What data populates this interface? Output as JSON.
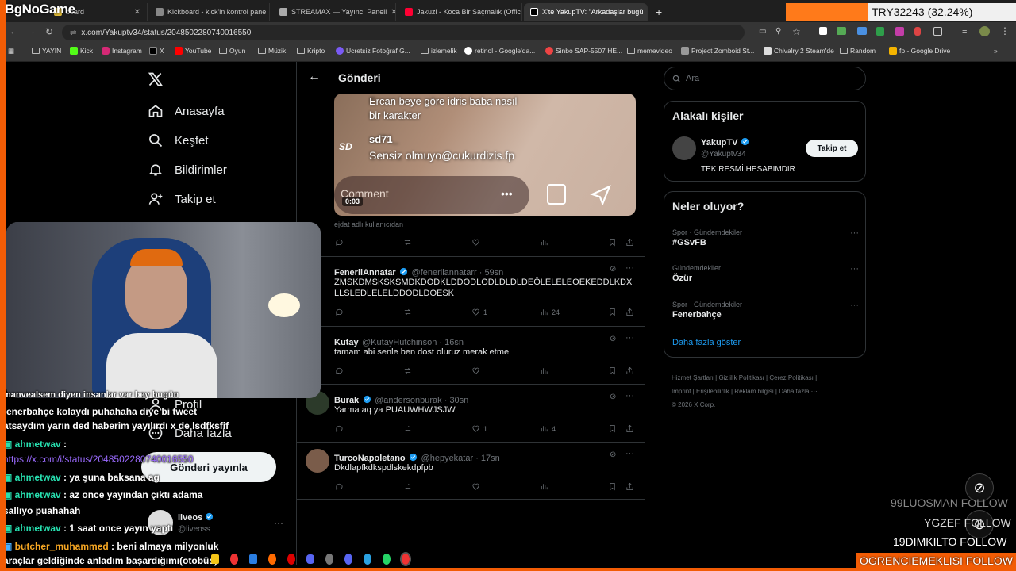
{
  "overlay": {
    "logo_text": "BgNoGame",
    "top_right_text": "TRY32243 (32.24%)"
  },
  "browser": {
    "tabs": [
      {
        "label": "board",
        "color": "#e8c23a"
      },
      {
        "label": "Kickboard - kick'in kontrol pane",
        "color": "#888888"
      },
      {
        "label": "STREAMAX — Yayıncı Paneli",
        "color": "#aaaaaa"
      },
      {
        "label": "Jakuzi - Koca Bir Saçmalık (Offic",
        "color": "#ff0033"
      },
      {
        "label": "X'te YakupTV: \"Arkadaşlar bugü",
        "color": "#ffffff"
      }
    ],
    "new_tab_label": "+",
    "url": "x.com/Yakuptv34/status/2048502280740016550",
    "bookmarks": [
      "YAYIN",
      "Kick",
      "Instagram",
      "X",
      "YouTube",
      "Oyun",
      "Müzik",
      "Kripto",
      "Ücretsiz Fotoğraf G...",
      "izlemelik",
      "retinol - Google'da...",
      "Sinbo SAP-5507 HE...",
      "memevideo",
      "Project Zomboid St...",
      "Chivalry 2 Steam'de",
      "Random",
      "fp - Google Drive"
    ]
  },
  "x_nav": {
    "items": [
      {
        "label": "Anasayfa",
        "icon": "home-icon"
      },
      {
        "label": "Keşfet",
        "icon": "search-icon"
      },
      {
        "label": "Bildirimler",
        "icon": "bell-icon"
      },
      {
        "label": "Takip et",
        "icon": "add-person-icon"
      }
    ],
    "profile_label": "Profil",
    "more_label": "Daha fazla",
    "post_button": "Gönderi yayınla",
    "account_name": "liveos",
    "account_handle": "@liveoss"
  },
  "header": {
    "title": "Gönderi"
  },
  "video": {
    "line1": "Ercan beye göre idris baba nasıl",
    "line2": "bir karakter",
    "user": "sd71_",
    "comment": "Sensiz olmuyo@cukurdizis.fp",
    "comment_placeholder": "Comment",
    "time": "0:03",
    "source_text": "ejdat adlı kullanıcıdan"
  },
  "replies": [
    {
      "name": "FenerliAnnatar",
      "handle": "@fenerliannatarr",
      "time": "59sn",
      "text": "ZMSKDMSKSKSMDKDODKLDDODLODLDLDLDEÖLELELEOEKEDDLKDXLLSLEDLELELDDODLDOESK",
      "likes": "1",
      "views": "24"
    },
    {
      "name": "Kutay",
      "handle": "@KutayHutchinson",
      "time": "16sn",
      "text": "tamam abi senle ben dost oluruz merak etme",
      "likes": "",
      "views": ""
    },
    {
      "name": "Burak",
      "handle": "@andersonburak",
      "time": "30sn",
      "text": "Yarma aq ya PUAUWHWJSJW",
      "likes": "1",
      "views": "4"
    },
    {
      "name": "TurcoNapoletano",
      "handle": "@hepyekatar",
      "time": "17sn",
      "text": "Dkdlapfkdkspdlskekdpfpb",
      "likes": "",
      "views": ""
    }
  ],
  "search": {
    "placeholder": "Ara"
  },
  "related": {
    "title": "Alakalı kişiler",
    "name": "YakupTV",
    "handle": "@Yakuptv34",
    "bio": "TEK RESMİ HESABIMDIR",
    "follow_button": "Takip et"
  },
  "trends": {
    "title": "Neler oluyor?",
    "items": [
      {
        "context": "Spor · Gündemdekiler",
        "name": "#GSvFB"
      },
      {
        "context": "Gündemdekiler",
        "name": "Özür"
      },
      {
        "context": "Spor · Gündemdekiler",
        "name": "Fenerbahçe"
      }
    ],
    "show_more": "Daha fazla göster"
  },
  "footer": {
    "links": [
      "Hizmet Şartları",
      "Gizlilik Politikası",
      "Çerez Politikası",
      "Imprint",
      "Erişilebilirlik",
      "Reklam bilgisi",
      "Daha fazla ···"
    ],
    "copyright": "© 2026 X Corp."
  },
  "chat": {
    "lines": [
      {
        "text": "manvealsem diyen insanlar var bey bugün"
      },
      {
        "text": "fenerbahçe kolaydı puhahaha diye bi tweet"
      },
      {
        "text": "atsaydım yarın ded haberim yayılırdı x de lsdfksfif"
      },
      {
        "user": "ahmetwav",
        "text": ":"
      },
      {
        "link": "https://x.com/i/status/2048502280740016550"
      },
      {
        "user": "ahmetwav",
        "text": ": ya şuna baksana ag"
      },
      {
        "user": "ahmetwav",
        "text": ": az once yayından çıktı adama"
      },
      {
        "text": "sallıyo puahahah"
      },
      {
        "user": "ahmetwav",
        "text": ": 1 saat once yayın yaptı"
      },
      {
        "user": "butcher_muhammed",
        "text": ": beni almaya milyonluk"
      },
      {
        "text": "araçlar geldiğinde anladım başardığımı(otobüs)"
      }
    ],
    "user_color": "#27e0b0",
    "butcher_color": "#f5a623"
  },
  "follows": [
    {
      "name": "99LUOSMAN",
      "label": "FOLLOW"
    },
    {
      "name": "YGZEF",
      "label": "FOLLOW"
    },
    {
      "name": "19DIMKILTO",
      "label": "FOLLOW"
    },
    {
      "name": "OGRENCIEMEKLISI",
      "label": "FOLLOW"
    }
  ]
}
